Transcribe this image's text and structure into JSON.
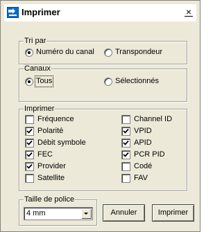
{
  "window": {
    "title": "Imprimer",
    "close_glyph": "×"
  },
  "sort_group": {
    "legend": "Tri par",
    "options": [
      {
        "label": "Numéro du canal",
        "selected": true
      },
      {
        "label": "Transpondeur",
        "selected": false
      }
    ]
  },
  "channels_group": {
    "legend": "Canaux",
    "options": [
      {
        "label": "Tous",
        "selected": true
      },
      {
        "label": "Sélectionnés",
        "selected": false
      }
    ]
  },
  "print_group": {
    "legend": "Imprimer",
    "left_column": [
      {
        "label": "Fréquence",
        "checked": false
      },
      {
        "label": "Polarité",
        "checked": true
      },
      {
        "label": "Débit symbole",
        "checked": true
      },
      {
        "label": "FEC",
        "checked": true
      },
      {
        "label": "Provider",
        "checked": true
      },
      {
        "label": "Satellite",
        "checked": false
      }
    ],
    "right_column": [
      {
        "label": "Channel ID",
        "checked": false
      },
      {
        "label": "VPID",
        "checked": true
      },
      {
        "label": "APID",
        "checked": true
      },
      {
        "label": "PCR PID",
        "checked": true
      },
      {
        "label": "Codé",
        "checked": false
      },
      {
        "label": "FAV",
        "checked": false
      }
    ]
  },
  "font_group": {
    "legend": "Taille de police",
    "selected_value": "4 mm"
  },
  "buttons": {
    "cancel_label": "Annuler",
    "print_label": "Imprimer"
  },
  "colors": {
    "dialog_background": "#ece9d8",
    "app_icon": "#0a6ec8"
  }
}
